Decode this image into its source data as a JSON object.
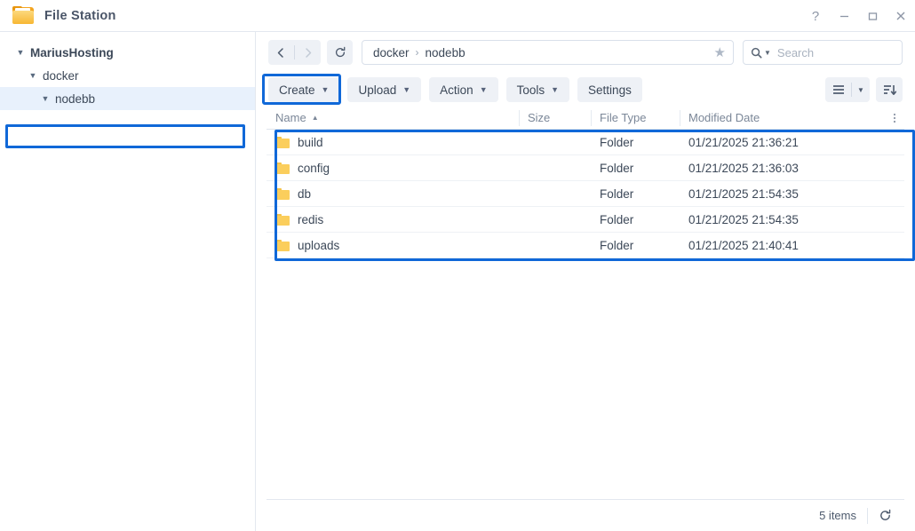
{
  "window": {
    "title": "File Station",
    "app_icon": "folder-icon",
    "controls": [
      {
        "name": "help-button",
        "glyph": "?"
      },
      {
        "name": "minimize-button",
        "glyph": "minimize-icon"
      },
      {
        "name": "maximize-button",
        "glyph": "maximize-icon"
      },
      {
        "name": "close-button",
        "glyph": "close-icon"
      }
    ]
  },
  "sidebar": {
    "items": [
      {
        "label": "MariusHosting",
        "level": 0,
        "expanded": true,
        "selected": false
      },
      {
        "label": "docker",
        "level": 1,
        "expanded": true,
        "selected": false
      },
      {
        "label": "nodebb",
        "level": 2,
        "expanded": true,
        "selected": true
      }
    ]
  },
  "navbar": {
    "back_icon": "chevron-left-icon",
    "forward_icon": "chevron-right-icon",
    "refresh_icon": "refresh-icon",
    "breadcrumb": [
      "docker",
      "nodebb"
    ],
    "breadcrumb_separator": "›",
    "favorite_icon": "star-icon",
    "search": {
      "placeholder": "Search",
      "icon": "search-icon"
    }
  },
  "toolbar": {
    "buttons": [
      {
        "label": "Create",
        "has_caret": true,
        "highlighted": true
      },
      {
        "label": "Upload",
        "has_caret": true,
        "highlighted": false
      },
      {
        "label": "Action",
        "has_caret": true,
        "highlighted": false
      },
      {
        "label": "Tools",
        "has_caret": true,
        "highlighted": false
      },
      {
        "label": "Settings",
        "has_caret": false,
        "highlighted": false
      }
    ],
    "view_icon": "list-view-icon",
    "view_caret_icon": "chevron-down-icon",
    "sort_icon": "sort-descending-icon"
  },
  "table": {
    "columns": [
      {
        "label": "Name",
        "sort": "asc"
      },
      {
        "label": "Size",
        "sort": null
      },
      {
        "label": "File Type",
        "sort": null
      },
      {
        "label": "Modified Date",
        "sort": null
      }
    ],
    "menu_icon": "more-vertical-icon",
    "rows": [
      {
        "icon": "folder-icon",
        "name": "build",
        "size": "",
        "type": "Folder",
        "modified": "01/21/2025 21:36:21"
      },
      {
        "icon": "folder-icon",
        "name": "config",
        "size": "",
        "type": "Folder",
        "modified": "01/21/2025 21:36:03"
      },
      {
        "icon": "folder-icon",
        "name": "db",
        "size": "",
        "type": "Folder",
        "modified": "01/21/2025 21:54:35"
      },
      {
        "icon": "folder-icon",
        "name": "redis",
        "size": "",
        "type": "Folder",
        "modified": "01/21/2025 21:54:35"
      },
      {
        "icon": "folder-icon",
        "name": "uploads",
        "size": "",
        "type": "Folder",
        "modified": "01/21/2025 21:40:41"
      }
    ]
  },
  "statusbar": {
    "items_label": "5 items",
    "refresh_icon": "refresh-icon"
  },
  "colors": {
    "annotation_blue": "#1068d8",
    "selected_row_bg": "#e8f1fc",
    "folder_yellow": "#fbce5c",
    "toolbar_button_bg": "#eef1f6"
  }
}
